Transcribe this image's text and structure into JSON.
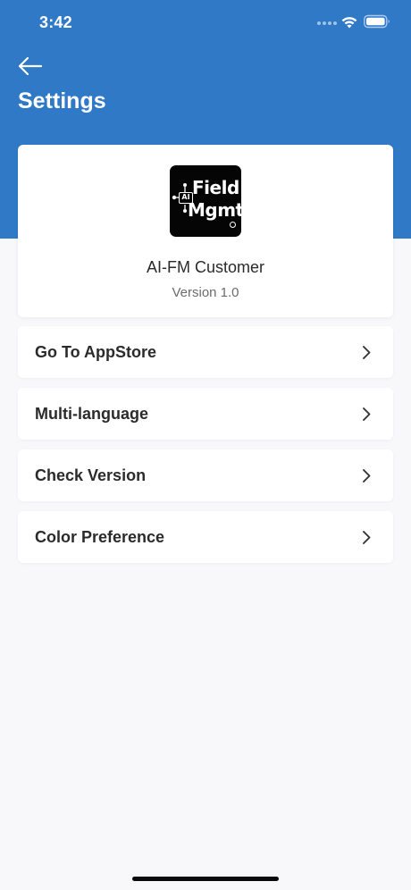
{
  "status_bar": {
    "time": "3:42",
    "icons": [
      "signal-dots-icon",
      "wifi-icon",
      "battery-icon"
    ]
  },
  "header": {
    "back_icon": "arrow-left-icon",
    "title": "Settings",
    "background_color": "#2f79c7"
  },
  "app_info": {
    "logo": {
      "text_line1": "Field",
      "text_line2": "Mgmt",
      "badge": "AI"
    },
    "name": "AI-FM Customer",
    "version": "Version 1.0"
  },
  "settings": {
    "items": [
      {
        "label": "Go To AppStore",
        "icon": "chevron-right-icon"
      },
      {
        "label": "Multi-language",
        "icon": "chevron-right-icon"
      },
      {
        "label": "Check Version",
        "icon": "chevron-right-icon"
      },
      {
        "label": "Color Preference",
        "icon": "chevron-right-icon"
      }
    ]
  }
}
